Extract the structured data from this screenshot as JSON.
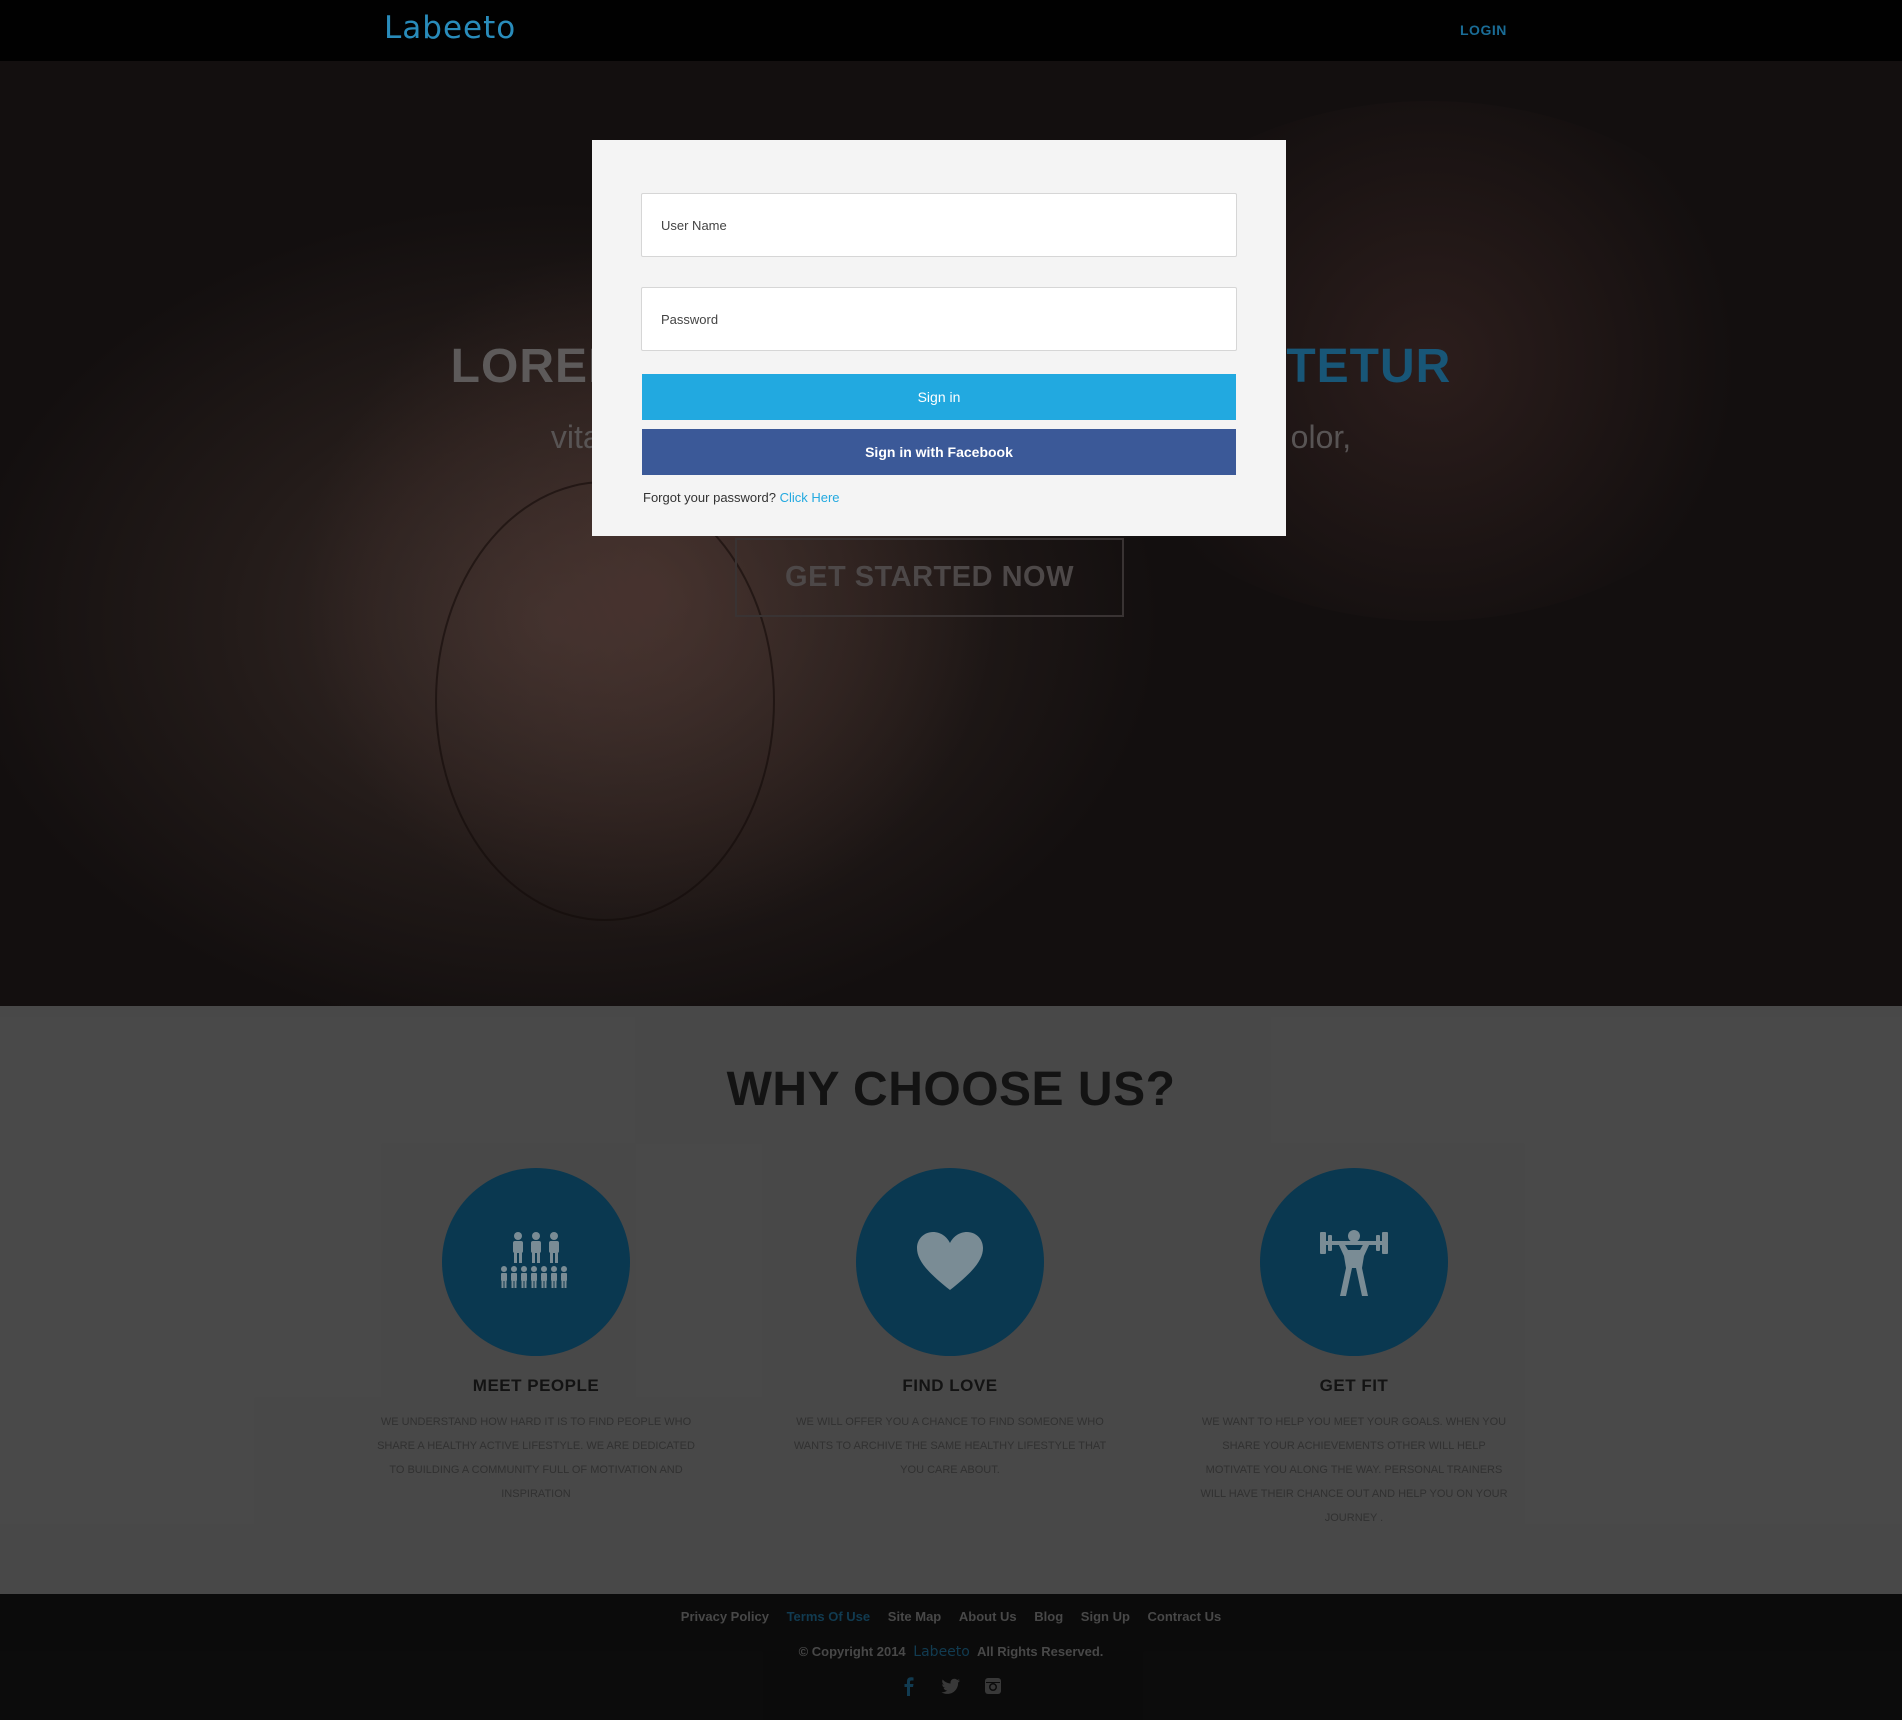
{
  "header": {
    "logo_text": "Labeeto",
    "login_label": "LOGIN"
  },
  "hero": {
    "title_start": "LOREM I",
    "title_end": "ECTETUR",
    "subtitle_start": "vita",
    "subtitle_end": "olor,",
    "cta_label": "GET STARTED NOW"
  },
  "modal": {
    "username_placeholder": "User Name",
    "password_placeholder": "Password",
    "signin_label": "Sign in",
    "facebook_label": "Sign in with Facebook",
    "forgot_text": "Forgot your password?",
    "forgot_link": "Click Here"
  },
  "why": {
    "title": "WHY CHOOSE US?",
    "features": [
      {
        "icon": "people-icon",
        "title": "MEET PEOPLE",
        "text": "WE UNDERSTAND HOW HARD IT IS TO FIND PEOPLE WHO SHARE A HEALTHY ACTIVE LIFESTYLE. WE ARE DEDICATED TO BUILDING A COMMUNITY FULL OF MOTIVATION AND INSPIRATION"
      },
      {
        "icon": "heart-icon",
        "title": "FIND LOVE",
        "text": "WE WILL OFFER YOU A CHANCE TO FIND SOMEONE WHO WANTS TO ARCHIVE THE SAME HEALTHY LIFESTYLE THAT YOU CARE ABOUT."
      },
      {
        "icon": "weightlifter-icon",
        "title": "GET FIT",
        "text": "WE WANT TO HELP YOU MEET YOUR GOALS. WHEN YOU SHARE YOUR ACHIEVEMENTS OTHER WILL HELP MOTIVATE YOU ALONG THE WAY. PERSONAL TRAINERS WILL HAVE THEIR CHANCE OUT AND HELP YOU ON YOUR JOURNEY ."
      }
    ]
  },
  "footer": {
    "links": [
      "Privacy Policy",
      "Terms Of Use",
      "Site Map",
      "About Us",
      "Blog",
      "Sign Up",
      "Contract Us"
    ],
    "copyright_prefix": "© Copyright 2014",
    "copyright_logo": "Labeeto",
    "copyright_suffix": "All Rights Reserved.",
    "socials": [
      "facebook-icon",
      "twitter-icon",
      "instagram-icon"
    ]
  },
  "colors": {
    "accent": "#22a9e0",
    "facebook": "#3b5998",
    "feature_circle": "#0b3a52"
  }
}
